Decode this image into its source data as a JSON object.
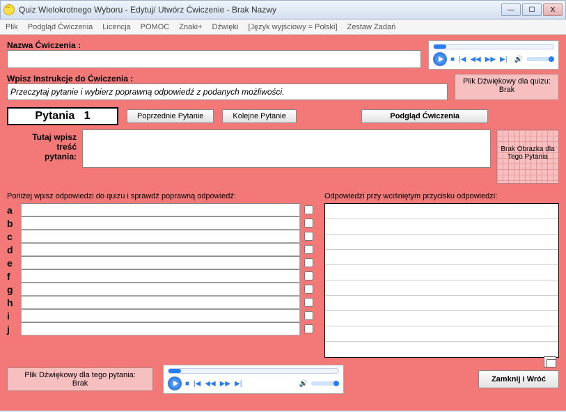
{
  "window": {
    "title": "Quiz Wielokrotnego Wyboru - Edytuj/ Utwórz Ćwiczenie - Brak Nazwy"
  },
  "menu": {
    "plik": "Plik",
    "podglad": "Podgląd Ćwiczenia",
    "licencja": "Licencja",
    "pomoc": "POMOC",
    "znaki": "Znaki+",
    "dzwieki": "Dźwięki",
    "jezyk": "[Język wyjściowy = Polski]",
    "zestaw": "Zestaw Zadań"
  },
  "labels": {
    "nazwa": "Nazwa Ćwiczenia :",
    "instrukcje": "Wpisz Instrukcje do Ćwiczenia :",
    "instrukcje_value": "Przeczytaj pytanie i wybierz poprawną odpowiedź z podanych możliwości.",
    "plik_dzw_quiz_l1": "Plik Dźwiękowy dla quizu:",
    "plik_dzw_quiz_l2": "Brak",
    "pytania": "Pytania",
    "pytania_num": "1",
    "poprzednie": "Poprzednie Pytanie",
    "kolejne": "Kolejne Pytanie",
    "podglad_cw": "Podgląd Ćwiczenia",
    "brak_obrazka_l1": "Brak Obrazka dla",
    "brak_obrazka_l2": "Tego Pytania",
    "tutaj_l1": "Tutaj wpisz",
    "tutaj_l2": "treść",
    "tutaj_l3": "pytania:",
    "odp_label": "Poniżej wpisz odpowiedzi do quizu i sprawdź poprawną odpowiedź:",
    "resp_label": "Odpowiedzi przy wciśniętym przycisku odpowiedzi:",
    "plik_dzw_pyt_l1": "Plik Dźwiękowy dla tego pytania:",
    "plik_dzw_pyt_l2": "Brak",
    "zamknij": "Zamknij i Wróć"
  },
  "letters": [
    "a",
    "b",
    "c",
    "d",
    "e",
    "f",
    "g",
    "h",
    "i",
    "j"
  ]
}
